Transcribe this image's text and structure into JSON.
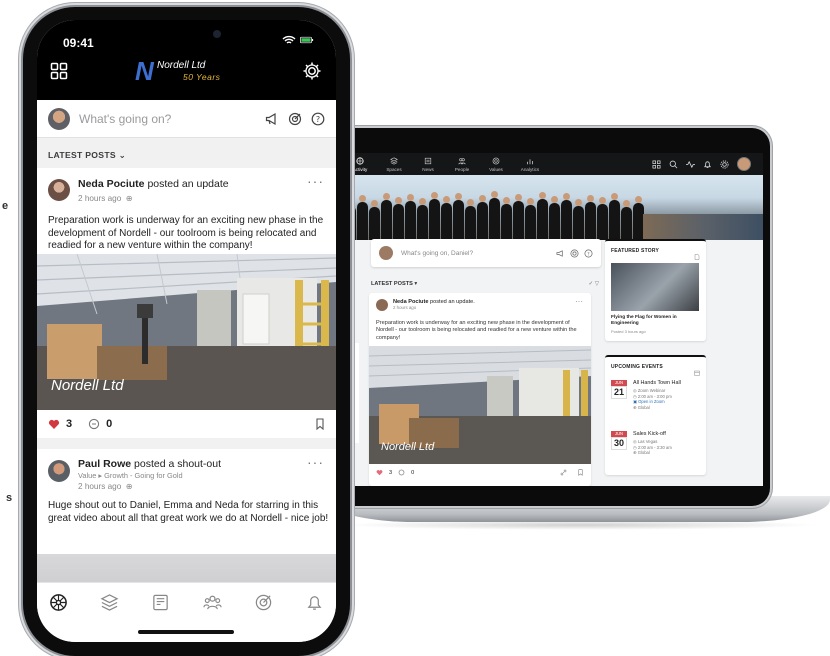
{
  "colors": {
    "accent_blue": "#3c6fd0",
    "brand_gold": "#e7b93b",
    "heart_red": "#d2383f",
    "event_red": "#d04a4f",
    "phone_black": "#000000"
  },
  "phone": {
    "status": {
      "time": "09:41",
      "icons": [
        "wifi-icon",
        "battery-icon"
      ]
    },
    "header": {
      "logo": {
        "mark": "N",
        "brand": "Nordell Ltd",
        "tagline": "50 Years"
      },
      "left_icon": "grid-icon",
      "right_icon": "gear-icon"
    },
    "compose": {
      "placeholder": "What's going on?",
      "icons": [
        "megaphone-icon",
        "target-icon",
        "question-icon"
      ]
    },
    "feed_header": "LATEST POSTS ⌄",
    "posts": [
      {
        "author": "Neda Pociute",
        "action": "posted an update",
        "time": "2 hours ago",
        "text": "Preparation work is underway for an exciting new phase in the development of Nordell - our toolroom is being relocated and readied for a new venture within the company!",
        "image_watermark": "Nordell Ltd",
        "likes": "3",
        "comments": "0"
      },
      {
        "author": "Paul Rowe",
        "action": "posted a shout-out",
        "category": "Value ▸ Growth - Going for Gold",
        "time": "2 hours ago",
        "text": "Huge shout out to Daniel, Emma and Neda for starring in this great video about all that great work we do at Nordell - nice job!"
      }
    ],
    "tabbar": [
      "activity-icon",
      "spaces-icon",
      "news-icon",
      "people-icon",
      "values-icon",
      "notifications-icon"
    ]
  },
  "laptop": {
    "nav": [
      {
        "label": "Activity",
        "icon": "activity-icon"
      },
      {
        "label": "Spaces",
        "icon": "spaces-icon"
      },
      {
        "label": "News",
        "icon": "news-icon"
      },
      {
        "label": "People",
        "icon": "people-icon"
      },
      {
        "label": "Values",
        "icon": "values-icon"
      },
      {
        "label": "Analytics",
        "icon": "analytics-icon"
      }
    ],
    "compose": {
      "placeholder": "What's going on, Daniel?"
    },
    "feed_header": "LATEST POSTS ▾",
    "post": {
      "author": "Neda Pociute",
      "action": "posted an update.",
      "time": "2 hours ago",
      "text": "Preparation work is underway for an exciting new phase in the development of Nordell - our toolroom is being relocated and readied for a new venture within the company!",
      "image_watermark": "Nordell Ltd",
      "likes": "3",
      "comments": "0"
    },
    "featured": {
      "title": "FEATURED STORY",
      "story_title": "Flying the Flag for Women in Engineering",
      "story_time": "Posted 3 hours ago"
    },
    "events": {
      "title": "UPCOMING EVENTS",
      "items": [
        {
          "month": "JUN",
          "day": "21",
          "name": "All Hands Town Hall",
          "location": "Zoom Webinar",
          "time": "2:00 am - 3:00 pm",
          "link": "Open in Zoom",
          "scope": "Global"
        },
        {
          "month": "JUN",
          "day": "30",
          "name": "Sales Kick-off",
          "location": "Las Vegas",
          "time": "2:00 am - 3:30 am",
          "scope": "Global"
        }
      ]
    }
  },
  "stray_text": {
    "e": "e",
    "s": "s"
  }
}
